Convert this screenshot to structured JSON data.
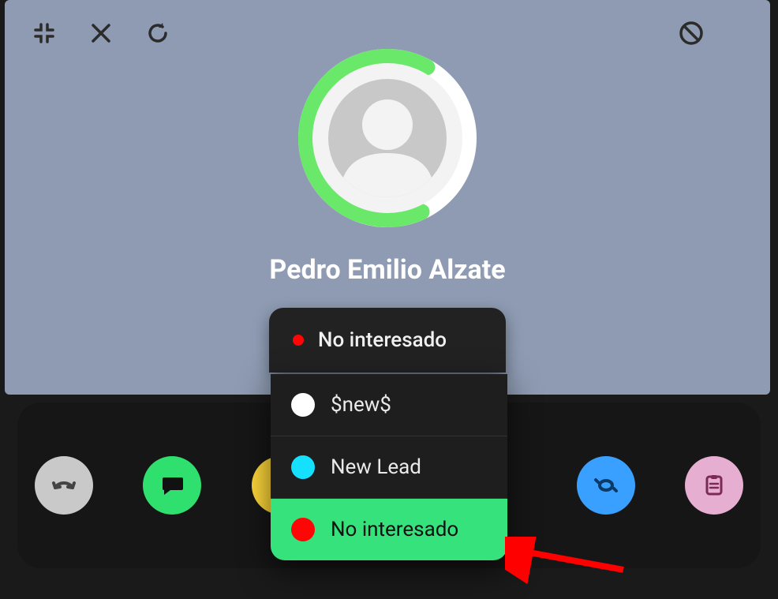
{
  "contact": {
    "name": "Pedro Emilio Alzate"
  },
  "status": {
    "current_label": "No interesado",
    "current_color": "#ff0505"
  },
  "dropdown": {
    "items": [
      {
        "label": "$new$",
        "color": "#ffffff",
        "selected": false
      },
      {
        "label": "New Lead",
        "color": "#15e0ff",
        "selected": false
      },
      {
        "label": "No interesado",
        "color": "#ff0505",
        "selected": true
      }
    ]
  },
  "icons": {
    "minimize": "minimize-icon",
    "close": "close-icon",
    "refresh": "refresh-icon",
    "block": "block-icon"
  },
  "actions": {
    "transfer": "transfer",
    "chat": "chat",
    "note": "note",
    "activity": "activity",
    "tasks": "tasks"
  },
  "colors": {
    "card_bg": "#8e9bb2",
    "accent_green": "#36e27c",
    "ring_green": "#6ae86a"
  }
}
